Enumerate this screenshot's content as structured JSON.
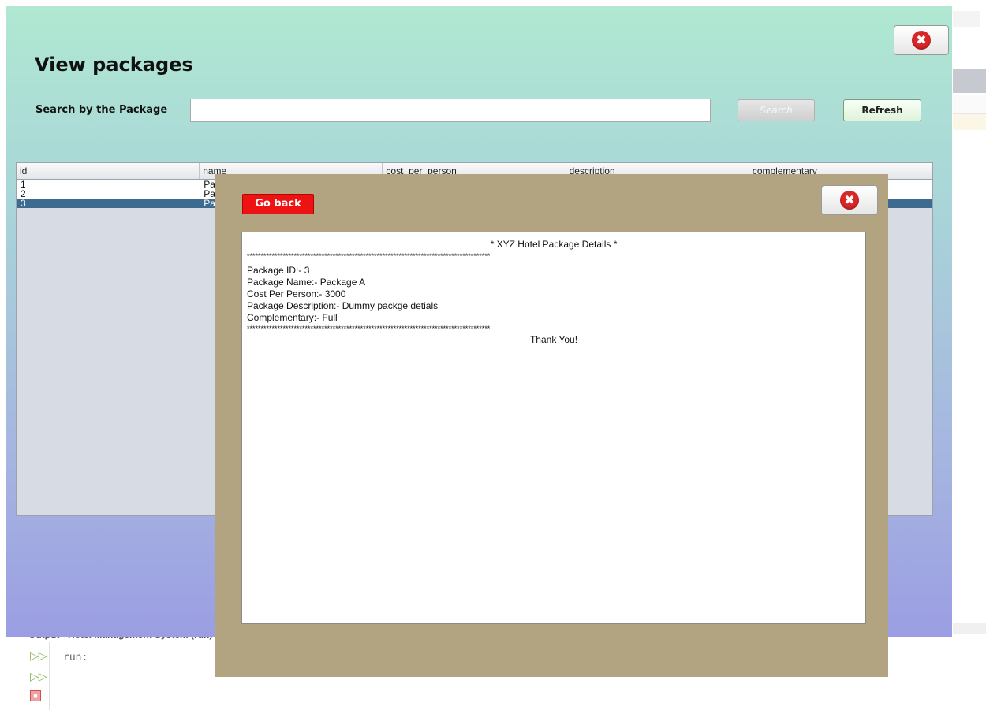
{
  "main": {
    "title": "View packages",
    "search_label": "Search by the Package",
    "search_value": "",
    "search_button": "Search",
    "refresh_button": "Refresh",
    "close_symbol": "✖"
  },
  "table": {
    "columns": [
      "id",
      "name",
      "cost_per_person",
      "description",
      "complementary"
    ],
    "rows": [
      [
        "1",
        "Pa",
        "",
        "",
        ""
      ],
      [
        "2",
        "Pa",
        "",
        "",
        ""
      ],
      [
        "3",
        "Pa",
        "",
        "",
        ""
      ]
    ],
    "selected_row": 3
  },
  "dialog": {
    "go_back_button": "Go back",
    "close_symbol": "✖",
    "receipt": {
      "header": "* XYZ Hotel Package Details *",
      "stars": "****************************************************************************************",
      "lines": [
        "Package ID:- 3",
        "Package Name:- Package A",
        "Cost Per Person:- 3000",
        "Package Description:- Dummy packge detials",
        "Complementary:- Full"
      ],
      "footer": "Thank You!"
    }
  },
  "ide": {
    "output_title": "Output - Hotel Management System (run)",
    "console_text": "run:",
    "icons": [
      "run-icon",
      "rerun-icon",
      "stop-icon"
    ]
  },
  "colors": {
    "gradient_top": "#b0e8d2",
    "gradient_bottom": "#9b9ee2",
    "dialog_bg": "#b2a381",
    "go_back": "#ee1313",
    "selected_row": "#3d6b8f"
  }
}
